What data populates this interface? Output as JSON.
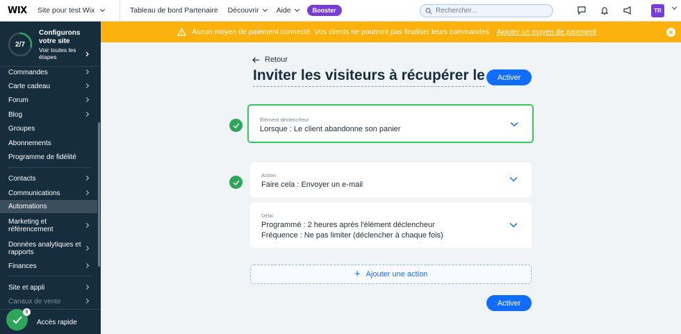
{
  "topbar": {
    "logo": "WIX",
    "site_name": "Site pour test Wix",
    "nav": [
      "Tableau de bord Partenaire",
      "Découvrir",
      "Aide"
    ],
    "booster": "Booster",
    "search_placeholder": "Rechercher...",
    "avatar": "TR"
  },
  "sidebar": {
    "progress": {
      "label": "2/7",
      "fraction": 0.2857,
      "title": "Configurons votre site",
      "subtitle": "Voir toutes les étapes"
    },
    "items": [
      {
        "label": "Commandes"
      },
      {
        "label": "Carte cadeau"
      },
      {
        "label": "Forum"
      },
      {
        "label": "Blog"
      },
      {
        "label": "Groupes"
      },
      {
        "label": "Abonnements"
      },
      {
        "label": "Programme de fidélité"
      },
      {
        "label": "Contacts"
      },
      {
        "label": "Communications"
      },
      {
        "label": "Automations"
      },
      {
        "label": "Marketing et référencement"
      },
      {
        "label": "Données analytiques et rapports"
      },
      {
        "label": "Finances"
      },
      {
        "label": "Site et appli"
      },
      {
        "label": "Canaux de vente"
      }
    ],
    "quick_access": "Accès rapide",
    "quick_badge": "8"
  },
  "banner": {
    "message": "Aucun moyen de paiement connecté. Vos clients ne pourront pas finaliser leurs commandes.",
    "link": "Ajouter un moyen de paiement"
  },
  "main": {
    "back": "Retour",
    "title": "Inviter les visiteurs à récupérer leur panier",
    "activate": "Activer",
    "trigger": {
      "caption": "Élément déclencheur",
      "value": "Lorsque : Le client abandonne son panier"
    },
    "action": {
      "caption": "Action",
      "value": "Faire cela : Envoyer un e-mail"
    },
    "delay": {
      "caption": "Délai",
      "line1": "Programmé : 2 heures après l'élément déclencheur",
      "line2": "Fréquence : Ne pas limiter (déclencher à chaque fois)"
    },
    "add_action": "Ajouter une action"
  },
  "colors": {
    "accent": "#116dff",
    "success": "#2fa55a",
    "warning": "#fdb10c",
    "sidebar": "#162d3d",
    "booster": "#7a3cd9"
  }
}
